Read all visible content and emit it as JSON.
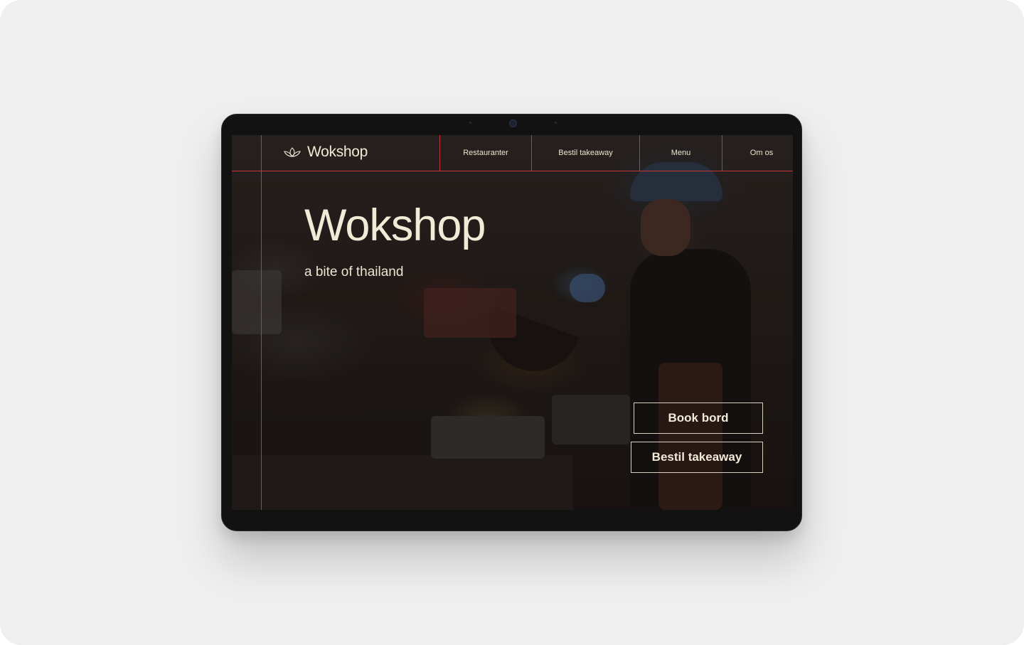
{
  "brand": {
    "logo_text": "Wokshop",
    "logo_icon": "lotus-icon"
  },
  "nav": {
    "items": [
      {
        "label": "Restauranter"
      },
      {
        "label": "Bestil takeaway"
      },
      {
        "label": "Menu"
      },
      {
        "label": "Om os"
      }
    ]
  },
  "hero": {
    "title": "Wokshop",
    "subtitle": "a bite of thailand",
    "background": "kitchen-chef-wok-photo"
  },
  "actions": {
    "book_label": "Book bord",
    "takeaway_label": "Bestil takeaway"
  },
  "colors": {
    "accent_line": "#c6343c",
    "text_cream": "#f1ead6",
    "frame_bg": "#efefef",
    "device": "#121212"
  }
}
